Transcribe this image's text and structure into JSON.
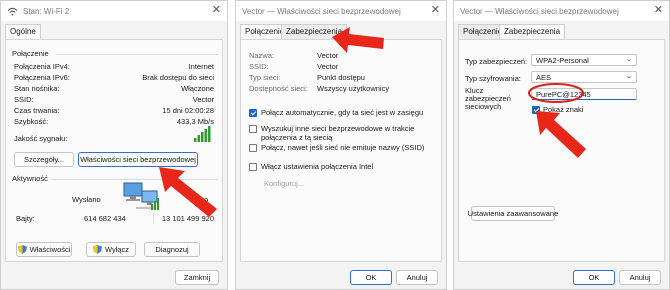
{
  "colors": {
    "accent": "#1d64c8",
    "arrow": "#e8261a",
    "highlight_ring": "#d9241c",
    "wifi_bars": "#2e9e2e"
  },
  "win1": {
    "title": "Stan: Wi-Fi 2",
    "tab": "Ogólne",
    "section_connection": "Połączenie",
    "rows": [
      {
        "label": "Połączenia IPv4:",
        "value": "Internet"
      },
      {
        "label": "Połączenia IPv6:",
        "value": "Brak dostępu do sieci"
      },
      {
        "label": "Stan nośnika:",
        "value": "Włączone"
      },
      {
        "label": "SSID:",
        "value": "Vector"
      },
      {
        "label": "Czas trwania:",
        "value": "15 dni 02:00:28"
      },
      {
        "label": "Szybkość:",
        "value": "433,3 Mb/s"
      }
    ],
    "signal_label": "Jakość sygnału:",
    "details_button": "Szczegóły...",
    "wireless_props_button": "Właściwości sieci bezprzewodowej",
    "section_activity": "Aktywność",
    "sent_label": "Wysłano",
    "received_label_partial": "o",
    "bytes_label": "Bajty:",
    "bytes_sent": "614 682 434",
    "bytes_received": "13 101 499 920",
    "properties_button": "Właściwości",
    "disable_button": "Wyłącz",
    "diagnose_button": "Diagnozuj",
    "close_button": "Zamknij"
  },
  "win2": {
    "title": "Vector — Właściwości sieci bezprzewodowej",
    "tabs": [
      "Połączenie",
      "Zabezpieczenia"
    ],
    "rows": [
      {
        "label": "Nazwa:",
        "value": "Vector"
      },
      {
        "label": "SSID:",
        "value": "Vector"
      },
      {
        "label": "Typ sieci:",
        "value": "Punkt dostępu"
      },
      {
        "label": "Dostępność sieci:",
        "value": "Wszyscy użytkownicy"
      }
    ],
    "checkboxes": [
      {
        "label": "Połącz automatycznie, gdy ta sieć jest w zasięgu",
        "checked": true
      },
      {
        "label": "Wyszukuj inne sieci bezprzewodowe w trakcie połączenia z tą siecią",
        "checked": false
      },
      {
        "label": "Połącz, nawet jeśli sieć nie emituje nazwy (SSID)",
        "checked": false
      },
      {
        "label": "Włącz ustawienia połączenia Intel",
        "checked": false
      }
    ],
    "configure_button": "Konfiguruj...",
    "ok_button": "OK",
    "cancel_button": "Anuluj"
  },
  "win3": {
    "title": "Vector — Właściwości sieci bezprzewodowej",
    "tabs": [
      "Połączenie",
      "Zabezpieczenia"
    ],
    "security_type_label": "Typ zabezpieczeń:",
    "security_type_value": "WPA2-Personal",
    "encryption_type_label": "Typ szyfrowania:",
    "encryption_type_value": "AES",
    "key_label": "Klucz zabezpieczeń sieciowych",
    "key_value": "PurePC@12345",
    "show_chars_label": "Pokaż znaki",
    "show_chars_checked": true,
    "advanced_button": "Ustawienia zaawansowane",
    "ok_button": "OK",
    "cancel_button": "Anuluj"
  }
}
